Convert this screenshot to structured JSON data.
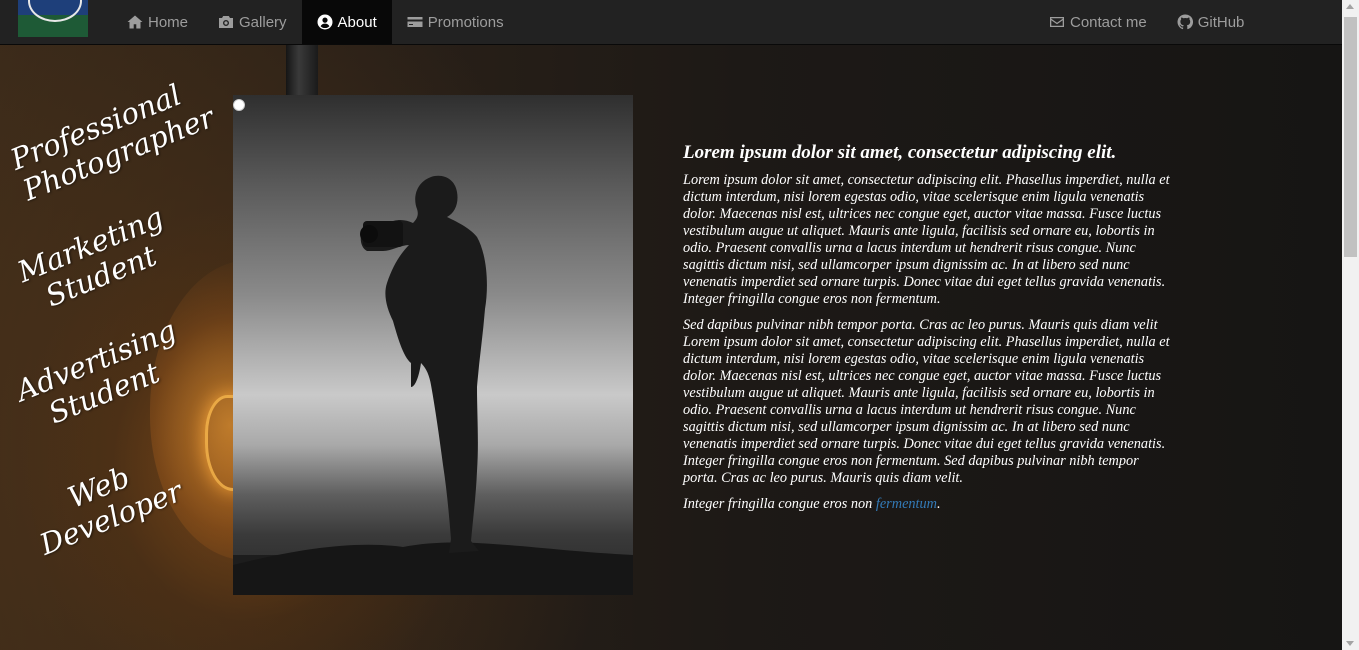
{
  "navbar": {
    "left_items": [
      {
        "label": "Home",
        "icon": "home-icon",
        "active": false
      },
      {
        "label": "Gallery",
        "icon": "camera-icon",
        "active": false
      },
      {
        "label": "About",
        "icon": "user-circle-icon",
        "active": true
      },
      {
        "label": "Promotions",
        "icon": "credit-card-icon",
        "active": false
      }
    ],
    "right_items": [
      {
        "label": "Contact me",
        "icon": "envelope-icon"
      },
      {
        "label": "GitHub",
        "icon": "github-icon"
      }
    ]
  },
  "taglines": [
    {
      "line1": "Professional",
      "line2": "Photographer"
    },
    {
      "line1": "Marketing",
      "line2": "Student"
    },
    {
      "line1": "Advertising",
      "line2": "Student"
    },
    {
      "line1": "Web",
      "line2": "Developer"
    }
  ],
  "article": {
    "heading": "Lorem ipsum dolor sit amet, consectetur adipiscing elit.",
    "paragraph1": "Lorem ipsum dolor sit amet, consectetur adipiscing elit. Phasellus imperdiet, nulla et dictum interdum, nisi lorem egestas odio, vitae scelerisque enim ligula venenatis dolor. Maecenas nisl est, ultrices nec congue eget, auctor vitae massa. Fusce luctus vestibulum augue ut aliquet. Mauris ante ligula, facilisis sed ornare eu, lobortis in odio. Praesent convallis urna a lacus interdum ut hendrerit risus congue. Nunc sagittis dictum nisi, sed ullamcorper ipsum dignissim ac. In at libero sed nunc venenatis imperdiet sed ornare turpis. Donec vitae dui eget tellus gravida venenatis. Integer fringilla congue eros non fermentum.",
    "paragraph2": "Sed dapibus pulvinar nibh tempor porta. Cras ac leo purus. Mauris quis diam velit Lorem ipsum dolor sit amet, consectetur adipiscing elit. Phasellus imperdiet, nulla et dictum interdum, nisi lorem egestas odio, vitae scelerisque enim ligula venenatis dolor. Maecenas nisl est, ultrices nec congue eget, auctor vitae massa. Fusce luctus vestibulum augue ut aliquet. Mauris ante ligula, facilisis sed ornare eu, lobortis in odio. Praesent convallis urna a lacus interdum ut hendrerit risus congue. Nunc sagittis dictum nisi, sed ullamcorper ipsum dignissim ac. In at libero sed nunc venenatis imperdiet sed ornare turpis. Donec vitae dui eget tellus gravida venenatis. Integer fringilla congue eros non fermentum. Sed dapibus pulvinar nibh tempor porta. Cras ac leo purus. Mauris quis diam velit.",
    "paragraph3_prefix": "Integer fringilla congue eros non ",
    "paragraph3_link": "fermentum",
    "paragraph3_suffix": "."
  },
  "colors": {
    "navbar_bg": "#222222",
    "nav_active_bg": "#080808",
    "nav_text": "#9d9d9d",
    "link": "#337ab7"
  }
}
